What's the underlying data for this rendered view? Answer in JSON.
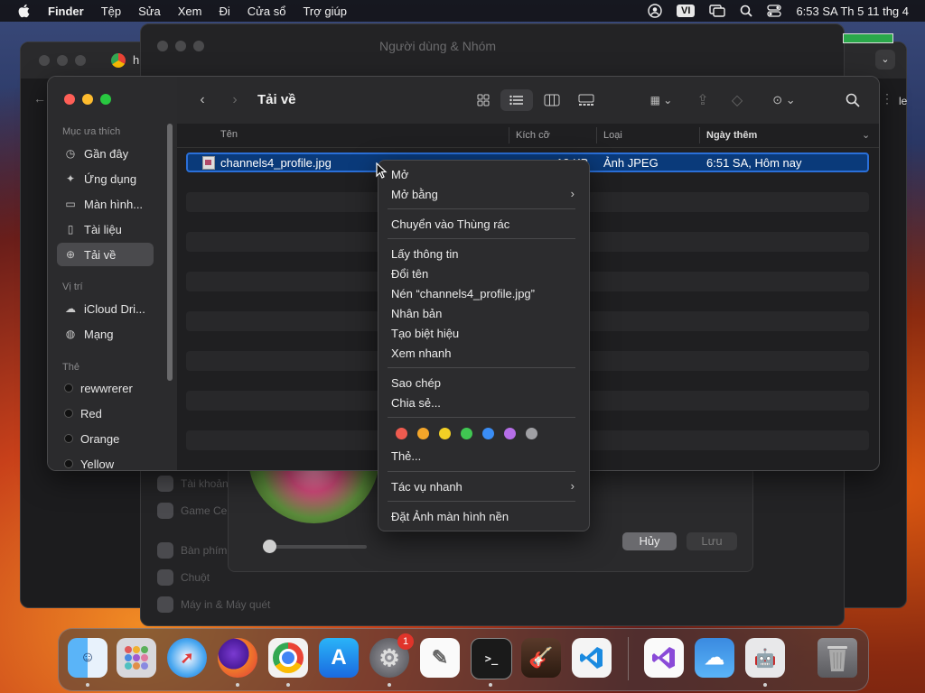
{
  "menubar": {
    "app_name": "Finder",
    "items": [
      "Tệp",
      "Sửa",
      "Xem",
      "Đi",
      "Cửa sổ",
      "Trợ giúp"
    ],
    "input_source": "VI",
    "clock": "6:53 SA Th 5 11 thg 4"
  },
  "background": {
    "settings_title": "Người dùng & Nhóm",
    "settings_items": [
      "Tài khoản",
      "Game Center",
      "Bàn phím",
      "Chuột",
      "Máy in & Máy quét"
    ],
    "cancel_label": "Hủy",
    "save_label": "Lưu",
    "browser_tab_letter": "h",
    "edge_text": "le"
  },
  "finder": {
    "title": "Tải về",
    "sidebar": {
      "favorites_header": "Mục ưa thích",
      "favorites": [
        "Gần đây",
        "Ứng dụng",
        "Màn hình...",
        "Tài liệu",
        "Tải về"
      ],
      "locations_header": "Vị trí",
      "locations": [
        "iCloud Dri...",
        "Mạng"
      ],
      "tags_header": "Thẻ",
      "tags": [
        "rewwrerer",
        "Red",
        "Orange",
        "Yellow"
      ]
    },
    "columns": {
      "name": "Tên",
      "size": "Kích cỡ",
      "kind": "Loại",
      "date_added": "Ngày thêm"
    },
    "file": {
      "name": "channels4_profile.jpg",
      "size": "13 KB",
      "kind": "Ảnh JPEG",
      "date_added": "6:51 SA, Hôm nay"
    }
  },
  "context_menu": {
    "open": "Mở",
    "open_with": "Mở bằng",
    "move_to_trash": "Chuyển vào Thùng rác",
    "get_info": "Lấy thông tin",
    "rename": "Đổi tên",
    "compress": "Nén “channels4_profile.jpg”",
    "duplicate": "Nhân bản",
    "make_alias": "Tạo biệt hiệu",
    "quick_look": "Xem nhanh",
    "copy": "Sao chép",
    "share": "Chia sẻ...",
    "tag_colors": [
      "#ef5b4f",
      "#f4a62a",
      "#f2d025",
      "#40c752",
      "#3a8df5",
      "#b66ee8",
      "#a0a0a4"
    ],
    "tags": "Thẻ...",
    "quick_actions": "Tác vụ nhanh",
    "set_desktop_picture": "Đặt Ảnh màn hình nền"
  },
  "dock": {
    "apps": [
      "Finder",
      "Launchpad",
      "Safari",
      "Firefox",
      "Chrome",
      "App Store",
      "System Settings",
      "TextEdit",
      "Terminal",
      "GarageBand",
      "Visual Studio Code",
      "Visual Studio",
      "Weather",
      "Automator",
      "Trash"
    ],
    "settings_badge": "1"
  }
}
